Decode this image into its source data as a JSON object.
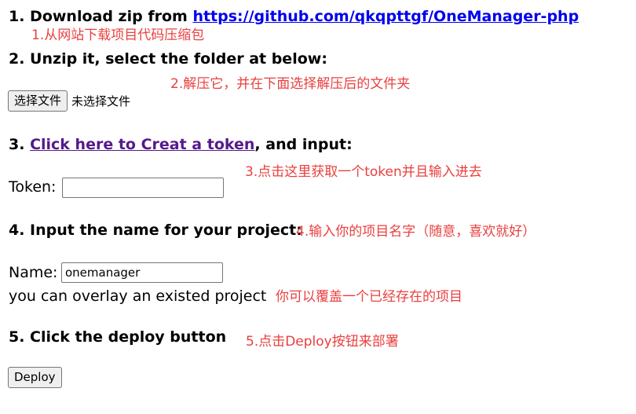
{
  "step1": {
    "prefix": "1. Download zip from ",
    "link": "https://github.com/qkqpttgf/OneManager-php",
    "note": "1.从网站下载项目代码压缩包"
  },
  "step2": {
    "text": "2. Unzip it, select the folder at below:",
    "note": "2.解压它，并在下面选择解压后的文件夹",
    "file_button": "选择文件",
    "file_status": "未选择文件"
  },
  "step3": {
    "prefix": "3. ",
    "link": "Click here to Creat a token",
    "suffix": ", and input:",
    "note": "3.点击这里获取一个token并且输入进去",
    "token_label": "Token:",
    "token_value": ""
  },
  "step4": {
    "text": "4. Input the name for your project:",
    "note": "4.输入你的项目名字（随意，喜欢就好）",
    "name_label": "Name:",
    "name_value": "onemanager",
    "overlay_text": "you can overlay an existed project",
    "overlay_note": "你可以覆盖一个已经存在的项目"
  },
  "step5": {
    "text": "5. Click the deploy button",
    "note": "5.点击Deploy按钮来部署",
    "deploy_button": "Deploy"
  },
  "colors": {
    "note": "#e8403f",
    "link": "#0000ee",
    "visited_link": "#551a8b"
  }
}
